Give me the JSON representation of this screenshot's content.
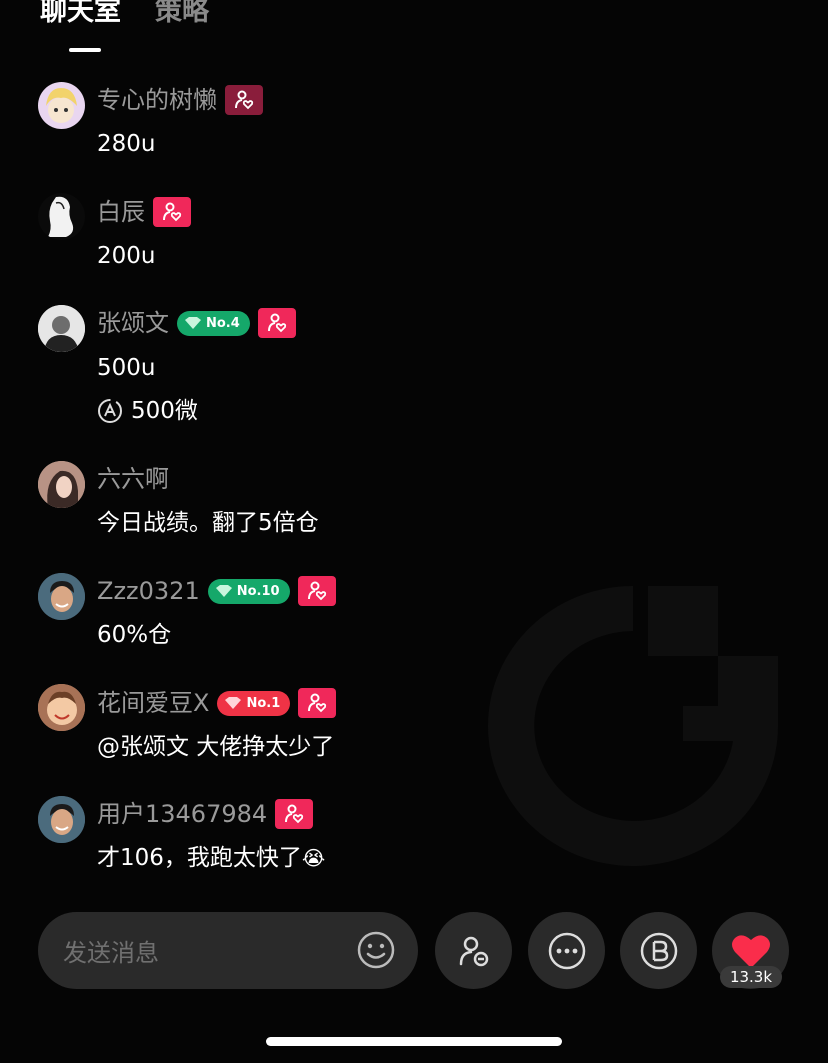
{
  "tabs": [
    {
      "label": "聊天室",
      "active": true
    },
    {
      "label": "策略",
      "active": false
    }
  ],
  "messages": [
    {
      "username": "专心的树懒",
      "text": "280u",
      "avatar": "cartoon-girl",
      "follow_dim": true
    },
    {
      "username": "白辰",
      "text": "200u",
      "avatar": "sketch-figure"
    },
    {
      "username": "张颂文",
      "rank": "No.4",
      "rank_color": "green",
      "text": "500u",
      "sub_text": "500微",
      "sub_icon": "points-icon",
      "avatar": "man-portrait"
    },
    {
      "username": "六六啊",
      "text": "今日战绩。翻了5倍仓",
      "avatar": "woman-portrait"
    },
    {
      "username": "Zzz0321",
      "rank": "No.10",
      "rank_color": "green",
      "text": "60%仓",
      "avatar": "smiling-man"
    },
    {
      "username": "花间爱豆X",
      "rank": "No.1",
      "rank_color": "red",
      "text": "@张颂文 大佬挣太少了",
      "avatar": "baby"
    },
    {
      "username": "用户13467984",
      "text": "才106，我跑太快了",
      "text_emoji": "😭",
      "avatar": "smiling-man"
    }
  ],
  "input": {
    "placeholder": "发送消息"
  },
  "like_count": "13.3k",
  "colors": {
    "background": "#050505",
    "accent": "#f0285a",
    "rank_green": "#15a86a",
    "rank_red": "#ef3346",
    "muted": "#9a9a9a"
  }
}
